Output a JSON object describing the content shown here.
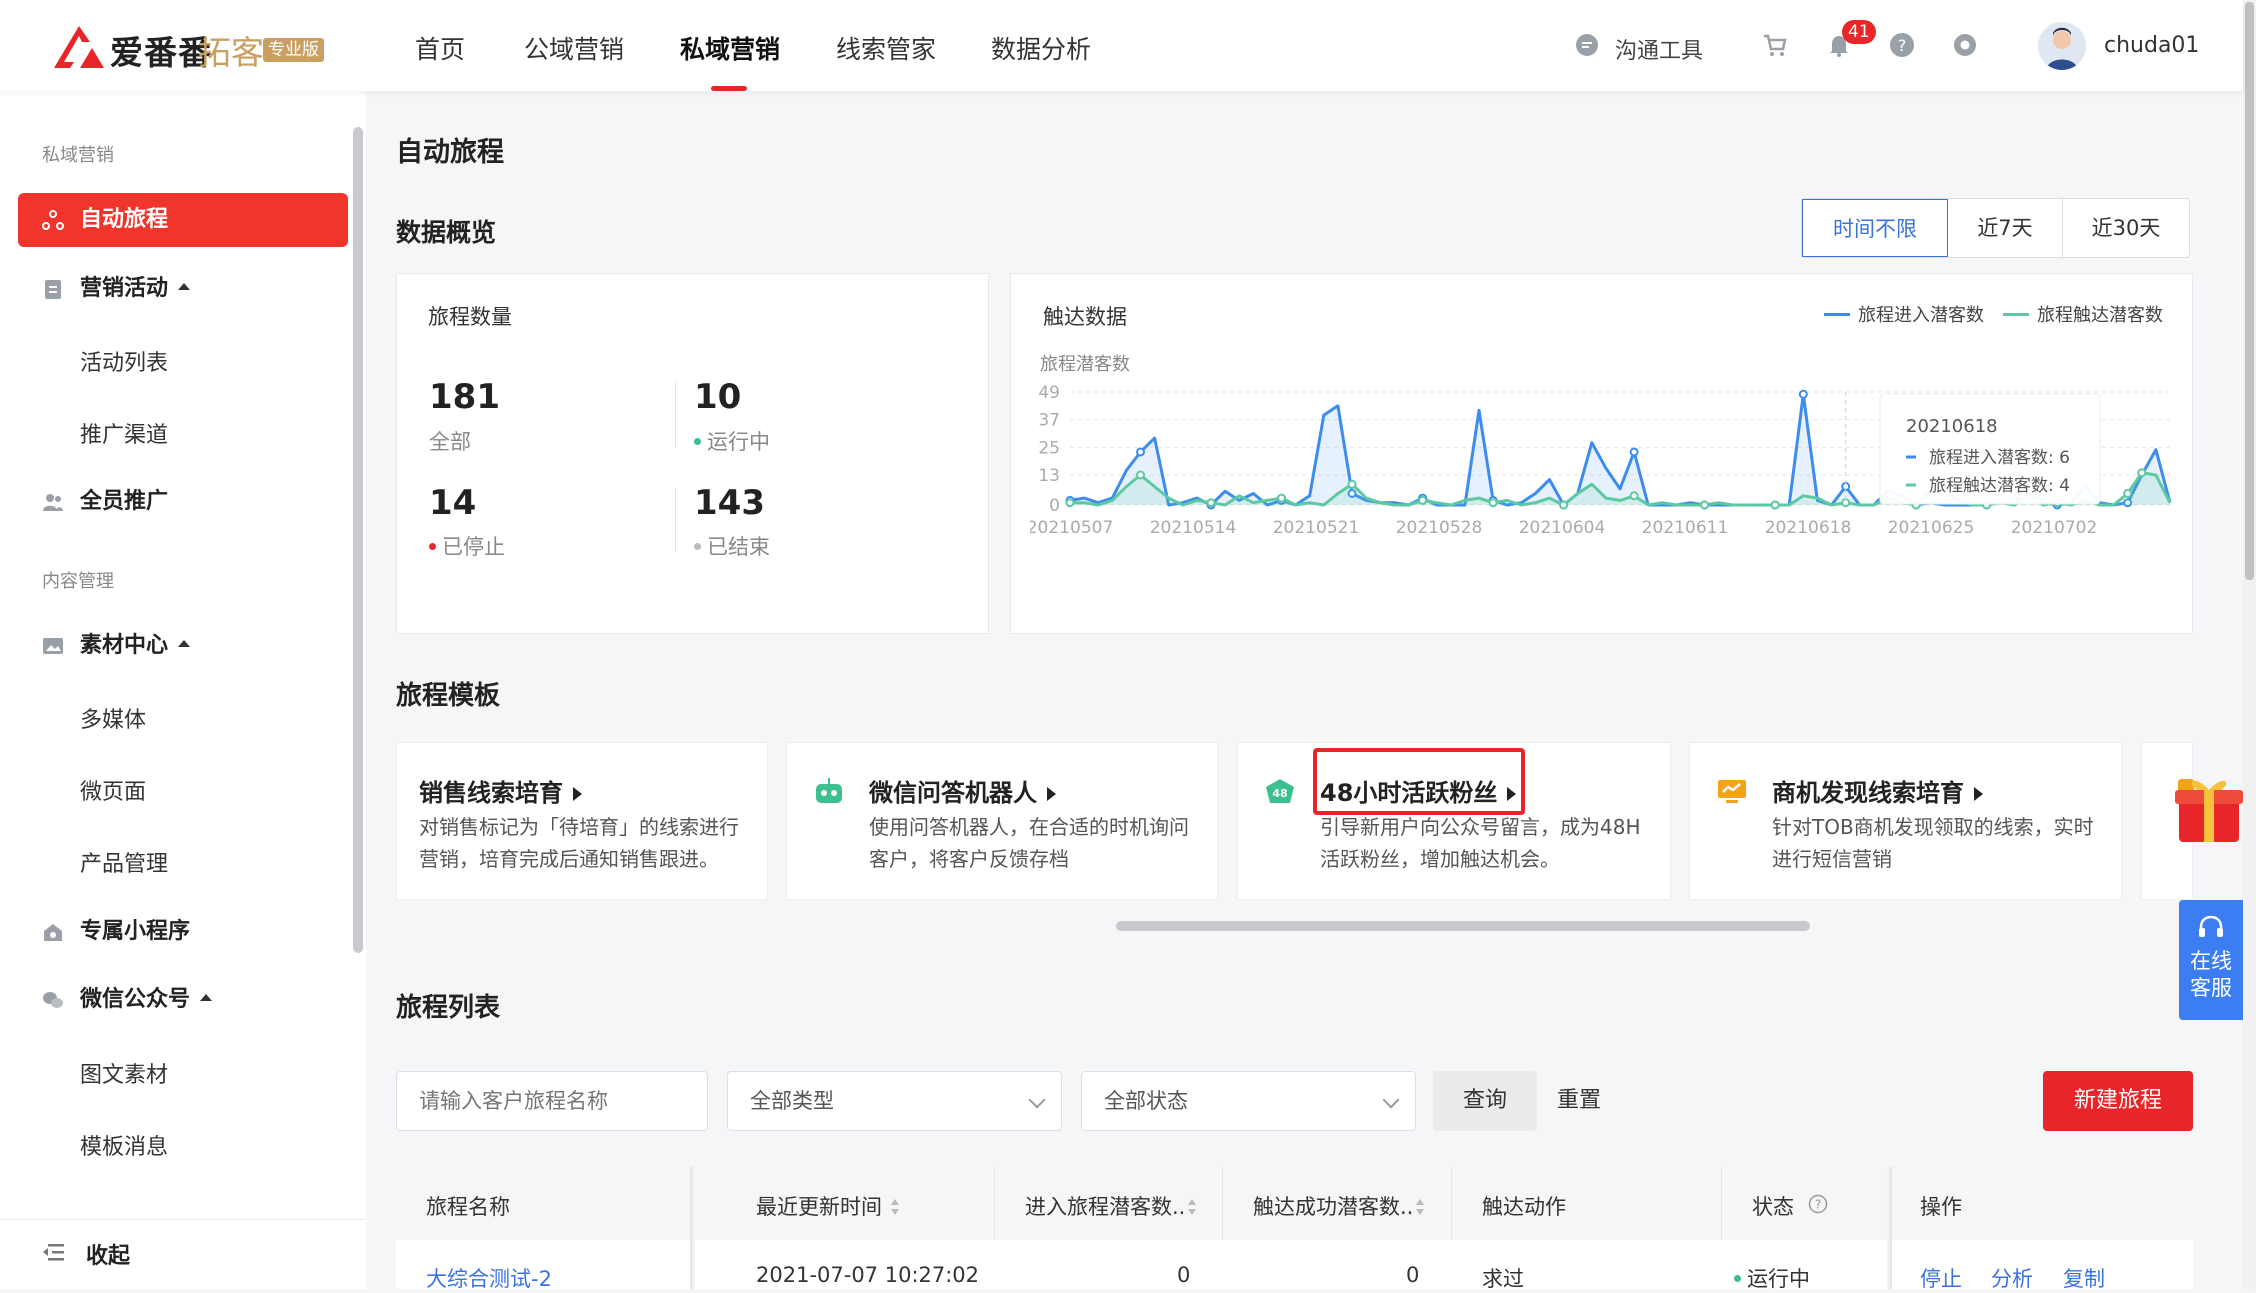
{
  "header": {
    "logo_text": "爱番番",
    "logo_sub": "拓客",
    "logo_badge": "专业版",
    "nav": [
      "首页",
      "公域营销",
      "私域营销",
      "线索管家",
      "数据分析"
    ],
    "tools_label": "沟通工具",
    "bell_count": "41",
    "username": "chuda01"
  },
  "sidebar": {
    "group1": "私域营销",
    "auto_journey": "自动旅程",
    "marketing_activity": "营销活动",
    "activity_list": "活动列表",
    "promo_channel": "推广渠道",
    "all_staff_promo": "全员推广",
    "group2": "内容管理",
    "material_center": "素材中心",
    "multimedia": "多媒体",
    "micro_page": "微页面",
    "product_mgmt": "产品管理",
    "mini_program": "专属小程序",
    "wechat_official": "微信公众号",
    "image_text": "图文素材",
    "template_msg": "模板消息",
    "collapse": "收起"
  },
  "main": {
    "page_title": "自动旅程",
    "overview_title": "数据概览",
    "ranges": [
      "时间不限",
      "近7天",
      "近30天"
    ],
    "stats_title": "旅程数量",
    "stats": [
      {
        "num": "181",
        "label": "全部"
      },
      {
        "num": "10",
        "label": "运行中"
      },
      {
        "num": "14",
        "label": "已停止"
      },
      {
        "num": "143",
        "label": "已结束"
      }
    ],
    "chart_title": "触达数据",
    "templates_title": "旅程模板",
    "templates": [
      {
        "title": "销售线索培育",
        "desc": "对销售标记为「待培育」的线索进行营销，培育完成后通知销售跟进。"
      },
      {
        "title": "微信问答机器人",
        "desc": "使用问答机器人，在合适的时机询问客户，将客户反馈存档"
      },
      {
        "title": "48小时活跃粉丝",
        "desc": "引导新用户向公众号留言，成为48H活跃粉丝，增加触达机会。"
      },
      {
        "title": "商机发现线索培育",
        "desc": "针对TOB商机发现领取的线索，实时进行短信营销"
      }
    ],
    "list_title": "旅程列表",
    "search_placeholder": "请输入客户旅程名称",
    "type_select": "全部类型",
    "status_select": "全部状态",
    "query_btn": "查询",
    "reset_btn": "重置",
    "new_btn": "新建旅程",
    "columns": [
      "旅程名称",
      "最近更新时间",
      "进入旅程潜客数..",
      "触达成功潜客数..",
      "触达动作",
      "状态",
      "操作"
    ],
    "rows": [
      {
        "name": "大综合测试-2",
        "updated": "2021-07-07 10:27:02",
        "entered": "0",
        "reached": "0",
        "action": "求过",
        "status": "运行中",
        "ops": [
          "停止",
          "分析",
          "复制"
        ]
      }
    ]
  },
  "service": {
    "line1": "在线",
    "line2": "客服"
  },
  "colors": {
    "brand_red": "#e8262a",
    "accent_blue": "#3a72e0",
    "series_blue": "#3c8cf0",
    "series_green": "#5cc9a0"
  },
  "chart_data": {
    "type": "line",
    "title": "触达数据",
    "ylabel": "旅程潜客数",
    "ylim": [
      0,
      49
    ],
    "yticks": [
      0,
      13,
      25,
      37,
      49
    ],
    "xticks": [
      "20210507",
      "20210514",
      "20210521",
      "20210528",
      "20210604",
      "20210611",
      "20210618",
      "20210625",
      "20210702"
    ],
    "legend_position": "top-right",
    "series": [
      {
        "name": "旅程进入潜客数",
        "color": "#3c8cf0",
        "values": [
          2,
          3,
          1,
          3,
          15,
          23,
          29,
          0,
          1,
          3,
          0,
          6,
          2,
          5,
          0,
          2,
          0,
          4,
          39,
          43,
          5,
          2,
          1,
          1,
          0,
          3,
          0,
          0,
          0,
          41,
          2,
          0,
          1,
          5,
          11,
          0,
          5,
          27,
          16,
          7,
          23,
          0,
          0,
          0,
          1,
          0,
          0,
          0,
          0,
          0,
          0,
          0,
          48,
          2,
          0,
          8,
          0,
          0,
          6,
          4,
          0,
          1,
          0,
          0,
          0,
          0,
          1,
          0,
          12,
          1,
          0,
          1,
          8,
          1,
          0,
          1,
          13,
          24,
          1
        ]
      },
      {
        "name": "旅程触达潜客数",
        "color": "#5cc9a0",
        "values": [
          1,
          1,
          0,
          2,
          8,
          13,
          8,
          3,
          0,
          2,
          1,
          0,
          4,
          1,
          2,
          3,
          0,
          1,
          0,
          5,
          9,
          3,
          1,
          0,
          0,
          2,
          1,
          0,
          2,
          3,
          1,
          2,
          0,
          1,
          3,
          0,
          5,
          9,
          3,
          2,
          4,
          0,
          1,
          0,
          0,
          0,
          1,
          0,
          0,
          0,
          0,
          0,
          4,
          3,
          0,
          1,
          0,
          0,
          3,
          1,
          0,
          6,
          6,
          2,
          0,
          0,
          1,
          0,
          5,
          0,
          1,
          0,
          2,
          0,
          0,
          5,
          14,
          13,
          1
        ]
      }
    ],
    "tooltip": {
      "date": "20210618",
      "line1": "旅程进入潜客数: 6",
      "line2": "旅程触达潜客数: 4"
    }
  }
}
